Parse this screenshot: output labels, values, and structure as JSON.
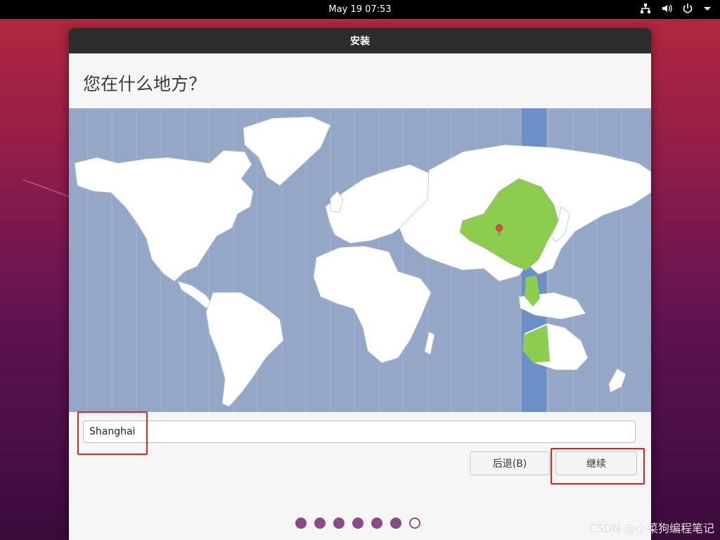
{
  "topbar": {
    "clock": "May 19  07:53",
    "icons": [
      "network-icon",
      "volume-icon",
      "power-icon",
      "menu-arrow-icon"
    ]
  },
  "window": {
    "title": "安装",
    "heading": "您在什么地方？"
  },
  "map": {
    "selected_timezone_band_color": "#6b8fc6",
    "selected_region_color": "#8ccc4f",
    "land_color": "#ffffff",
    "ocean_color": "#94a7c7",
    "pin_icon": "location-pin-icon"
  },
  "location_input": {
    "value": "Shanghai"
  },
  "buttons": {
    "back_label": "后退(B)",
    "continue_label": "继续"
  },
  "progress": {
    "total_steps": 7,
    "current_step": 7
  },
  "watermark": "CSDN @小菜狗编程笔记"
}
